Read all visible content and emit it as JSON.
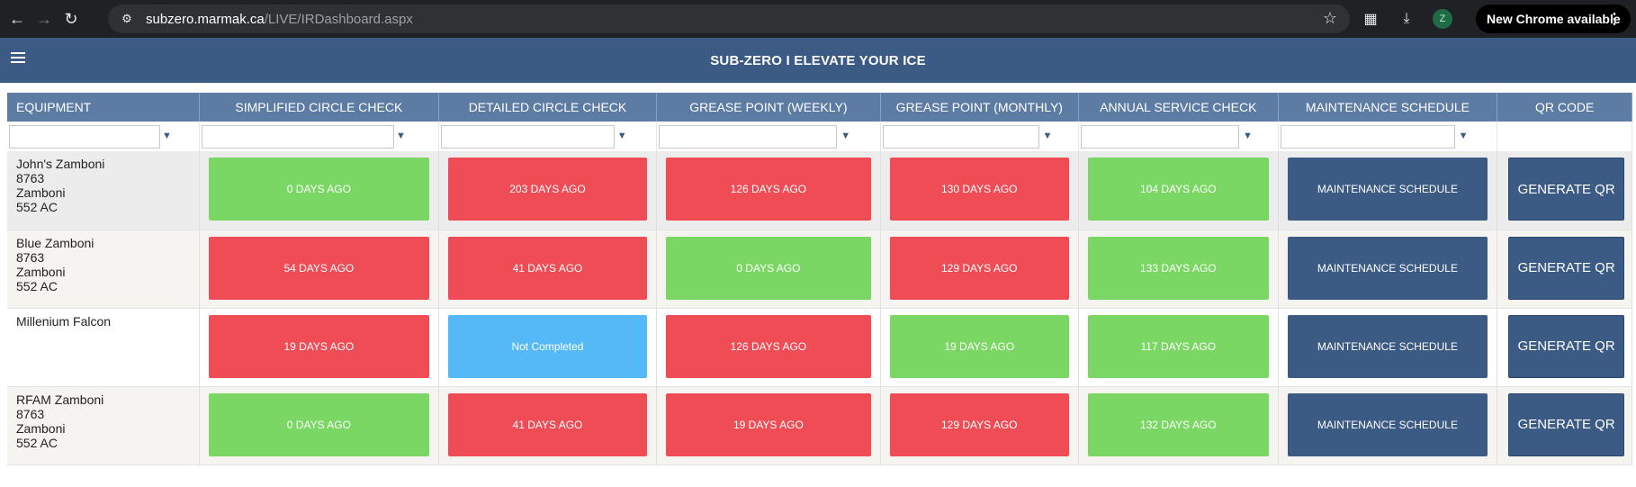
{
  "browser": {
    "url_host": "subzero.marmak.ca",
    "url_path": "/LIVE/IRDashboard.aspx",
    "profile_initial": "Z",
    "update_label": "New Chrome available"
  },
  "app": {
    "title": "SUB-ZERO I ELEVATE YOUR ICE"
  },
  "table": {
    "columns": [
      "EQUIPMENT",
      "SIMPLIFIED CIRCLE CHECK",
      "DETAILED CIRCLE CHECK",
      "GREASE POINT (WEEKLY)",
      "GREASE POINT (MONTHLY)",
      "ANNUAL SERVICE CHECK",
      "MAINTENANCE SCHEDULE",
      "QR CODE"
    ],
    "rows": [
      {
        "equipment": [
          "John's Zamboni",
          "8763",
          "Zamboni",
          "552 AC"
        ],
        "checks": [
          {
            "text": "0 DAYS AGO",
            "status": "green"
          },
          {
            "text": "203 DAYS AGO",
            "status": "red"
          },
          {
            "text": "126 DAYS AGO",
            "status": "red"
          },
          {
            "text": "130 DAYS AGO",
            "status": "red"
          },
          {
            "text": "104 DAYS AGO",
            "status": "green"
          }
        ],
        "maintenance_label": "MAINTENANCE SCHEDULE",
        "qr_label": "GENERATE QR"
      },
      {
        "equipment": [
          "Blue Zamboni",
          "8763",
          "Zamboni",
          "552 AC"
        ],
        "checks": [
          {
            "text": "54 DAYS AGO",
            "status": "red"
          },
          {
            "text": "41 DAYS AGO",
            "status": "red"
          },
          {
            "text": "0 DAYS AGO",
            "status": "green"
          },
          {
            "text": "129 DAYS AGO",
            "status": "red"
          },
          {
            "text": "133 DAYS AGO",
            "status": "green"
          }
        ],
        "maintenance_label": "MAINTENANCE SCHEDULE",
        "qr_label": "GENERATE QR"
      },
      {
        "equipment": [
          "Millenium Falcon"
        ],
        "checks": [
          {
            "text": "19 DAYS AGO",
            "status": "red"
          },
          {
            "text": "Not Completed",
            "status": "blue"
          },
          {
            "text": "126 DAYS AGO",
            "status": "red"
          },
          {
            "text": "19 DAYS AGO",
            "status": "green"
          },
          {
            "text": "117 DAYS AGO",
            "status": "green"
          }
        ],
        "maintenance_label": "MAINTENANCE SCHEDULE",
        "qr_label": "GENERATE QR"
      },
      {
        "equipment": [
          "RFAM Zamboni",
          "8763",
          "Zamboni",
          "552 AC"
        ],
        "checks": [
          {
            "text": "0 DAYS AGO",
            "status": "green"
          },
          {
            "text": "41 DAYS AGO",
            "status": "red"
          },
          {
            "text": "19 DAYS AGO",
            "status": "red"
          },
          {
            "text": "129 DAYS AGO",
            "status": "red"
          },
          {
            "text": "132 DAYS AGO",
            "status": "green"
          }
        ],
        "maintenance_label": "MAINTENANCE SCHEDULE",
        "qr_label": "GENERATE QR"
      }
    ]
  },
  "colors": {
    "header": "#3b5a84",
    "column_header": "#5d7ca4",
    "green": "#7bd764",
    "red": "#ef4c55",
    "blue": "#56b9f7"
  },
  "icons": {
    "back": "arrow-left-icon",
    "forward": "arrow-right-icon",
    "reload": "reload-icon",
    "site_info": "site-info-icon",
    "bookmark": "star-icon",
    "extensions": "puzzle-icon",
    "download": "download-icon",
    "menu": "hamburger-menu-icon",
    "filter": "filter-funnel-icon"
  }
}
